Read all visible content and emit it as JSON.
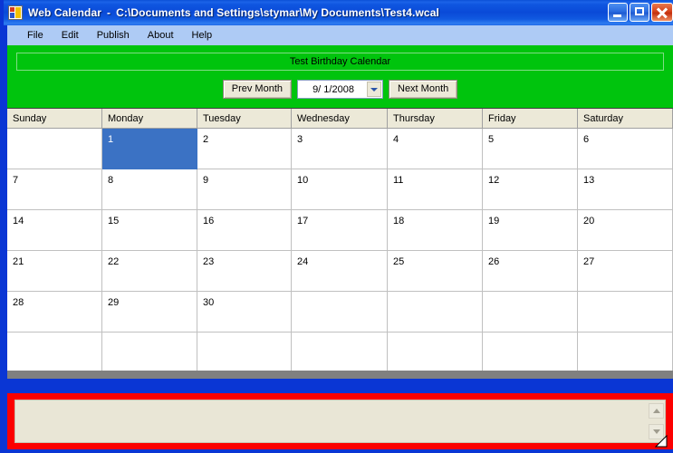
{
  "window": {
    "app_name": "Web Calendar",
    "separator": "-",
    "document_path": "C:\\Documents and Settings\\stymar\\My Documents\\Test4.wcal",
    "icon": "app-window-icon",
    "buttons": {
      "minimize": "minimize-icon",
      "maximize": "maximize-icon",
      "close": "close-icon"
    }
  },
  "menu": {
    "items": [
      {
        "label": "File"
      },
      {
        "label": "Edit"
      },
      {
        "label": "Publish"
      },
      {
        "label": "About"
      },
      {
        "label": "Help"
      }
    ]
  },
  "header": {
    "background_color": "#00c40d",
    "calendar_title": "Test Birthday Calendar",
    "prev_month_label": "Prev Month",
    "next_month_label": "Next Month",
    "date_value": "9/ 1/2008",
    "date_dropdown_icon": "chevron-down-icon"
  },
  "calendar": {
    "columns": [
      "Sunday",
      "Monday",
      "Tuesday",
      "Wednesday",
      "Thursday",
      "Friday",
      "Saturday"
    ],
    "selected_day": "1",
    "selection_color": "#3b72c4",
    "weeks": [
      [
        "",
        "1",
        "2",
        "3",
        "4",
        "5",
        "6"
      ],
      [
        "7",
        "8",
        "9",
        "10",
        "11",
        "12",
        "13"
      ],
      [
        "14",
        "15",
        "16",
        "17",
        "18",
        "19",
        "20"
      ],
      [
        "21",
        "22",
        "23",
        "24",
        "25",
        "26",
        "27"
      ],
      [
        "28",
        "29",
        "30",
        "",
        "",
        "",
        ""
      ],
      [
        "",
        "",
        "",
        "",
        "",
        "",
        ""
      ]
    ]
  },
  "notes_panel": {
    "border_color": "#fc0000",
    "text_value": "",
    "scroll_up_icon": "chevron-up-icon",
    "scroll_down_icon": "chevron-down-icon"
  }
}
